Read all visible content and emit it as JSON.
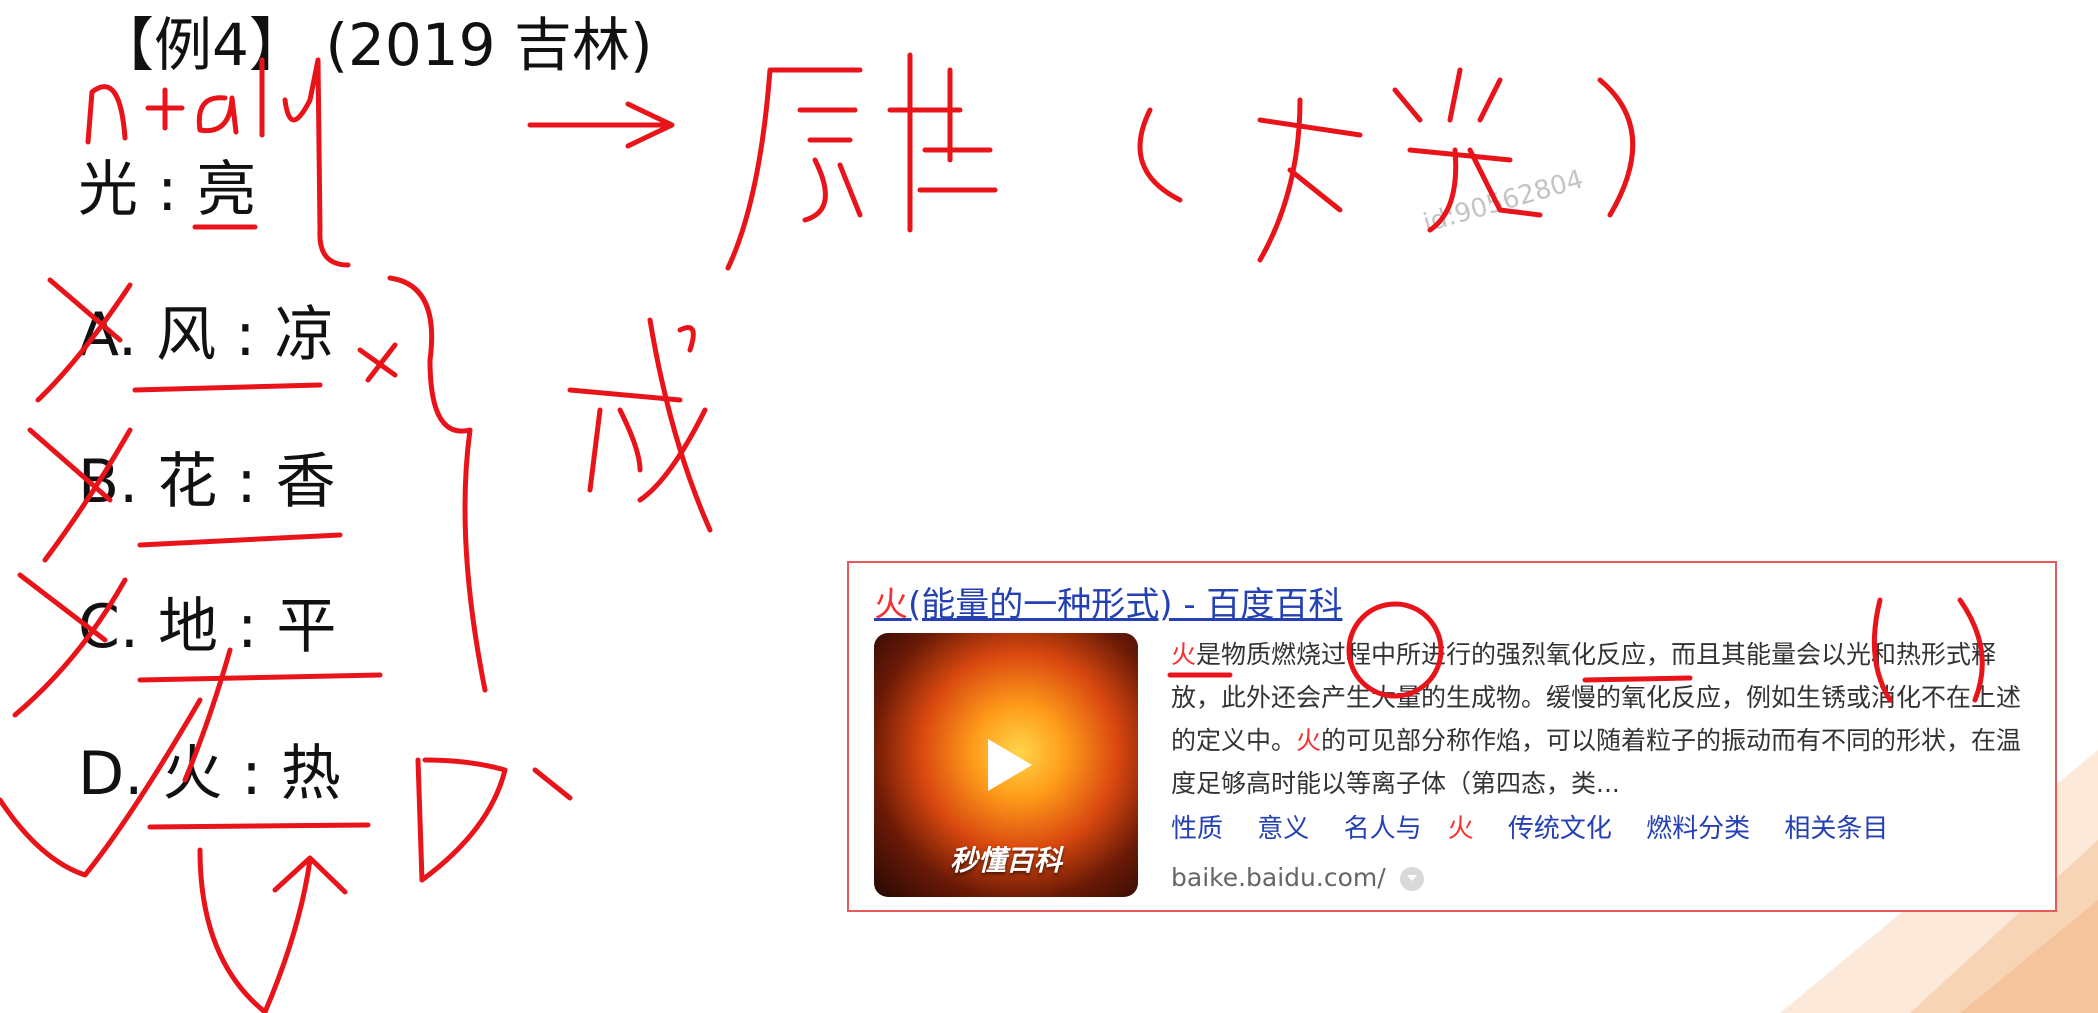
{
  "question": {
    "title": "【例4】 (2019 吉林)",
    "stem": "光 : 亮",
    "options": [
      {
        "letter": "A.",
        "text": "风 : 凉"
      },
      {
        "letter": "B.",
        "text": "花 : 香"
      },
      {
        "letter": "C.",
        "text": "地 : 平"
      },
      {
        "letter": "D.",
        "text": "火 : 热"
      }
    ]
  },
  "watermark": "id:90562804",
  "search_result": {
    "title_highlight": "火",
    "title_rest": "(能量的一种形式) - 百度百科",
    "abstract": [
      {
        "text": "火",
        "hl": true
      },
      {
        "text": "是物质燃烧过程中所进行的强烈氧化反应，而且其能量会以光和热形式释放，此外还会产生大量的生成物。缓慢的氧化反应，例如生锈或消化不在上述的定义中。",
        "hl": false
      },
      {
        "text": "火",
        "hl": true
      },
      {
        "text": "的可见部分称作焰，可以随着粒子的振动而有不同的形状，在温度足够高时能以等离子体（第四态，类...",
        "hl": false
      }
    ],
    "links": [
      "性质",
      "意义",
      "名人与",
      "传统文化",
      "燃料分类",
      "相关条目"
    ],
    "links_highlight": "火",
    "thumbnail_brand": "秒懂百科",
    "source": "baike.baidu.com/"
  },
  "colors": {
    "annotation": "#e8141a",
    "link": "#2440b3",
    "highlight": "#f73131",
    "card_border": "#e85a5a"
  }
}
